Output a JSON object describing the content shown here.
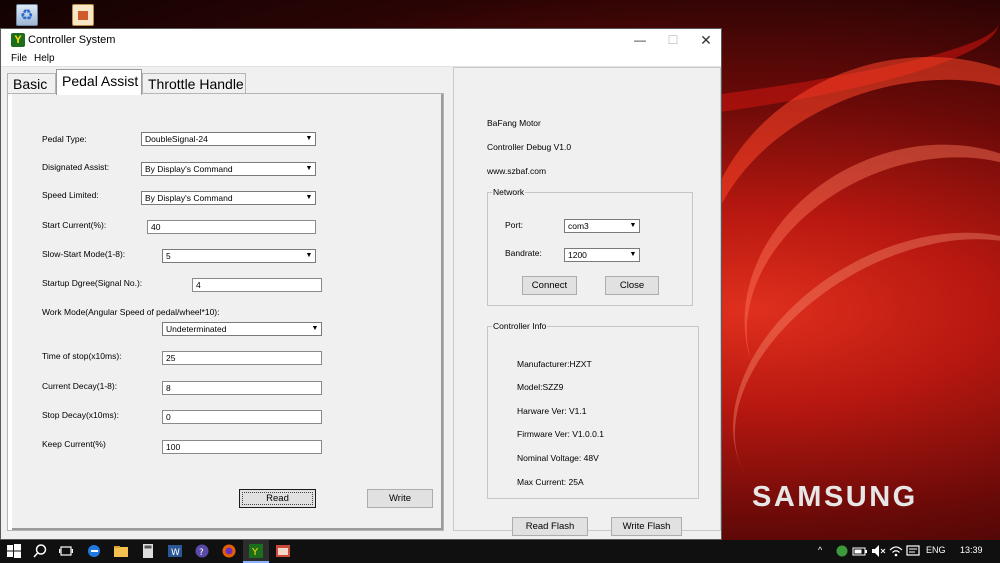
{
  "window": {
    "title": "Controller System",
    "menu": [
      "File",
      "Help"
    ],
    "controls": {
      "minimize": "—",
      "maximize": "☐",
      "close": "✕"
    }
  },
  "tabs": [
    {
      "label": "Basic",
      "selected": false
    },
    {
      "label": "Pedal Assist",
      "selected": true
    },
    {
      "label": "Throttle Handle",
      "selected": false
    }
  ],
  "pedal_assist": {
    "pedal_type": {
      "label": "Pedal Type:",
      "value": "DoubleSignal-24"
    },
    "designated_assist": {
      "label": "Disignated Assist:",
      "value": "By Display's Command"
    },
    "speed_limited": {
      "label": "Speed Limited:",
      "value": "By Display's Command"
    },
    "start_current": {
      "label": "Start Current(%):",
      "value": "40"
    },
    "slow_start_mode": {
      "label": "Slow-Start Mode(1-8):",
      "value": "5"
    },
    "startup_degree": {
      "label": "Startup Dgree(Signal No.):",
      "value": "4"
    },
    "work_mode": {
      "label": "Work Mode(Angular Speed of pedal/wheel*10):",
      "value": "Undeterminated"
    },
    "time_of_stop": {
      "label": "Time of stop(x10ms):",
      "value": "25"
    },
    "current_decay": {
      "label": "Current Decay(1-8):",
      "value": "8"
    },
    "stop_decay": {
      "label": "Stop Decay(x10ms):",
      "value": "0"
    },
    "keep_current": {
      "label": "Keep Current(%)",
      "value": "100"
    },
    "read_button": "Read",
    "write_button": "Write"
  },
  "info_panel": {
    "line1": "BaFang Motor",
    "line2": "Controller Debug V1.0",
    "line3": "www.szbaf.com",
    "network": {
      "title": "Network",
      "port_label": "Port:",
      "port_value": "com3",
      "baudrate_label": "Bandrate:",
      "baudrate_value": "1200",
      "connect_button": "Connect",
      "close_button": "Close"
    },
    "controller_info": {
      "title": "Controller Info",
      "manufacturer": "Manufacturer:HZXT",
      "model": "Model:SZZ9",
      "hardware": "Harware Ver: V1.1",
      "firmware": "Firmware Ver: V1.0.0.1",
      "voltage": "Nominal Voltage: 48V",
      "max_current": "Max Current: 25A"
    },
    "read_flash_button": "Read Flash",
    "write_flash_button": "Write Flash"
  },
  "desktop": {
    "brand": "SAMSUNG"
  },
  "taskbar": {
    "language": "ENG",
    "time": "13:39"
  }
}
